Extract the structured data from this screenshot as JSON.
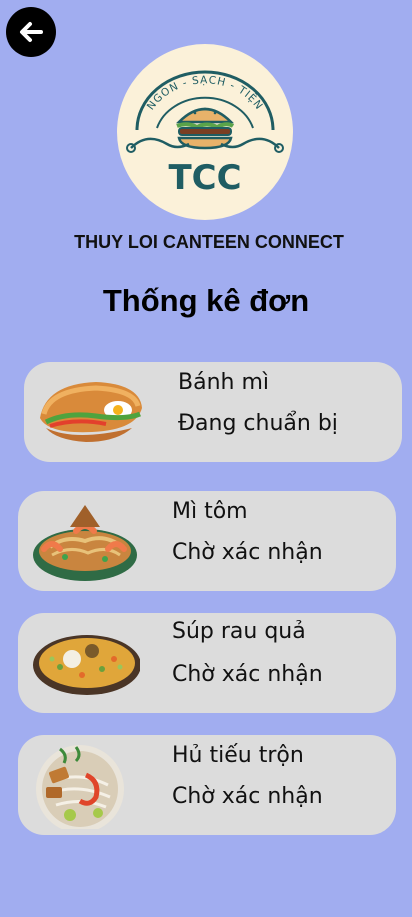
{
  "header": {
    "back_icon": "arrow-left-icon",
    "logo": {
      "tagline": "NGON - SẠCH - TIỆN",
      "initials": "TCC",
      "icon": "burger-icon"
    },
    "app_name": "THUY LOI CANTEEN CONNECT",
    "page_title": "Thống kê đơn"
  },
  "orders": [
    {
      "name": "Bánh mì",
      "status": "Đang chuẩn bị",
      "image": "banh-mi-image"
    },
    {
      "name": "Mì tôm",
      "status": "Chờ xác nhận",
      "image": "mi-tom-image"
    },
    {
      "name": "Súp rau quả",
      "status": "Chờ xác nhận",
      "image": "sup-rau-qua-image"
    },
    {
      "name": "Hủ tiếu trộn",
      "status": "Chờ xác nhận",
      "image": "hu-tieu-tron-image"
    }
  ],
  "colors": {
    "background": "#a1adf0",
    "card": "#dcdcdc",
    "logo_bg": "#fbf1d9",
    "logo_teal": "#1f5d63"
  }
}
